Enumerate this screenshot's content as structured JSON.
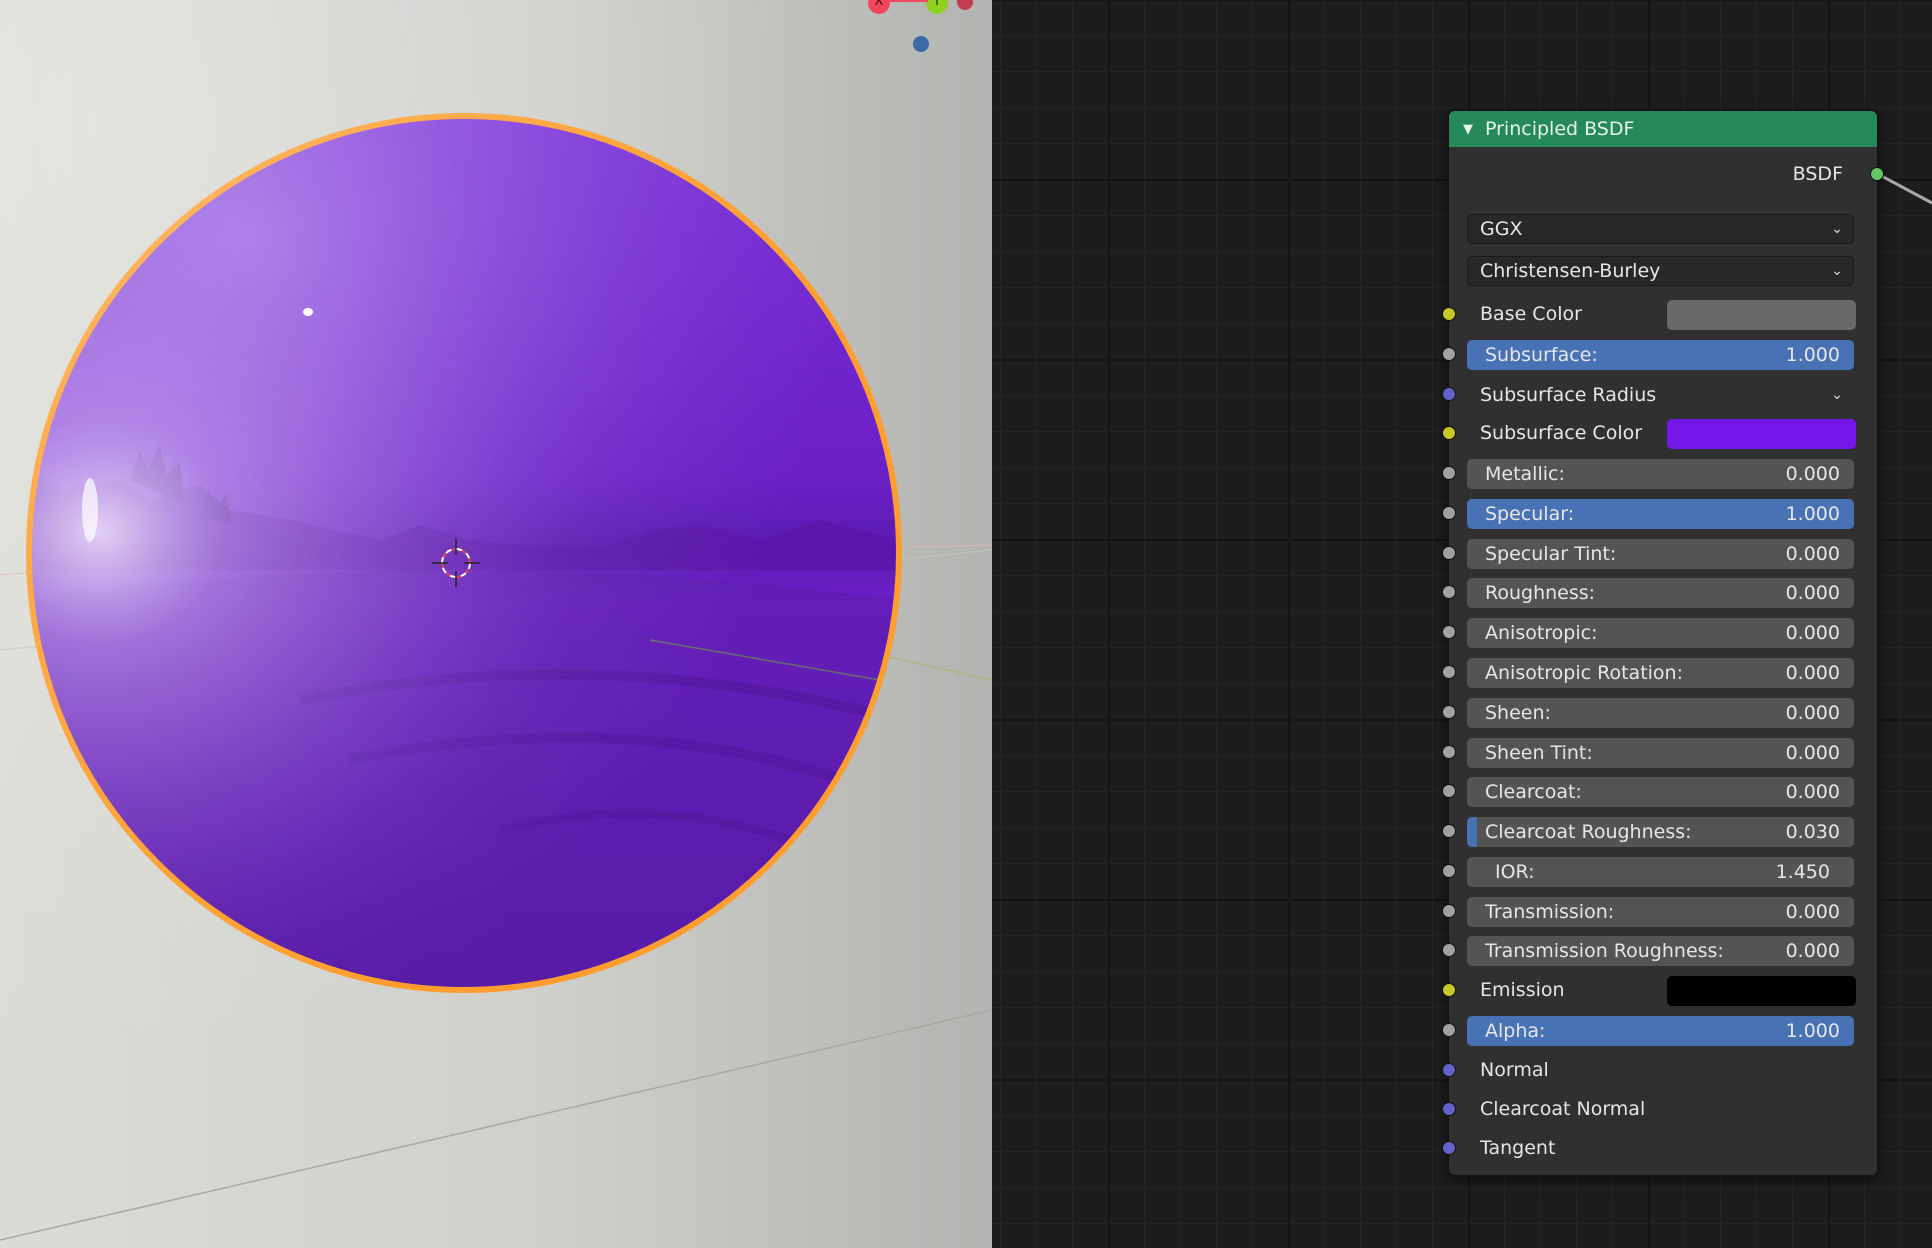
{
  "node": {
    "title": "Principled BSDF",
    "output": "BSDF",
    "distribution": "GGX",
    "subsurface_method": "Christensen-Burley",
    "base_color": {
      "label": "Base Color",
      "color": "#6b6868"
    },
    "subsurface": {
      "label": "Subsurface:",
      "value": "1.000"
    },
    "subsurface_radius": {
      "label": "Subsurface Radius"
    },
    "subsurface_color": {
      "label": "Subsurface Color",
      "color": "#7417e8"
    },
    "metallic": {
      "label": "Metallic:",
      "value": "0.000"
    },
    "specular": {
      "label": "Specular:",
      "value": "1.000"
    },
    "specular_tint": {
      "label": "Specular Tint:",
      "value": "0.000"
    },
    "roughness": {
      "label": "Roughness:",
      "value": "0.000"
    },
    "anisotropic": {
      "label": "Anisotropic:",
      "value": "0.000"
    },
    "anisotropic_rotation": {
      "label": "Anisotropic Rotation:",
      "value": "0.000"
    },
    "sheen": {
      "label": "Sheen:",
      "value": "0.000"
    },
    "sheen_tint": {
      "label": "Sheen Tint:",
      "value": "0.000"
    },
    "clearcoat": {
      "label": "Clearcoat:",
      "value": "0.000"
    },
    "clearcoat_roughness": {
      "label": "Clearcoat Roughness:",
      "value": "0.030"
    },
    "ior": {
      "label": "IOR:",
      "value": "1.450"
    },
    "transmission": {
      "label": "Transmission:",
      "value": "0.000"
    },
    "transmission_roughness": {
      "label": "Transmission Roughness:",
      "value": "0.000"
    },
    "emission": {
      "label": "Emission",
      "color": "#000000"
    },
    "alpha": {
      "label": "Alpha:",
      "value": "1.000"
    },
    "normal": {
      "label": "Normal"
    },
    "clearcoat_normal": {
      "label": "Clearcoat Normal"
    },
    "tangent": {
      "label": "Tangent"
    }
  },
  "viewport": {
    "gizmo_x": "X",
    "gizmo_y": "Y",
    "selection_outline_color": "#ff9e2e",
    "material_color": "#7a22d0"
  },
  "colors": {
    "socket_float": "#a1a1a1",
    "socket_color": "#c7c729",
    "socket_vector": "#6363c7",
    "socket_shader": "#63c763",
    "slider_fill": "#4772b3",
    "node_header": "#26895a"
  }
}
